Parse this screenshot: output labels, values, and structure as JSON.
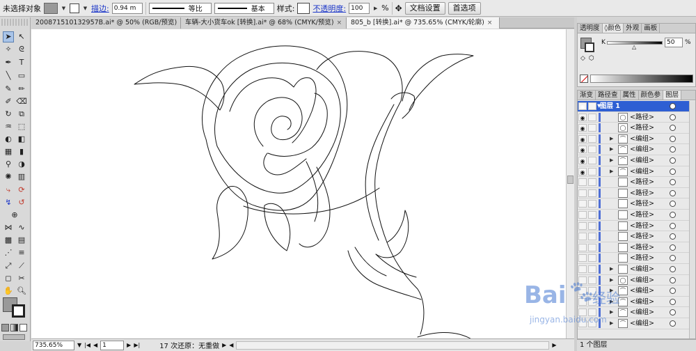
{
  "control_bar": {
    "selection_status": "未选择对象",
    "stroke_label": "描边:",
    "stroke_weight": "0.94 m",
    "variable_width_profile": "等比",
    "brush_definition": "基本",
    "style_label": "样式:",
    "opacity_label": "不透明度:",
    "opacity_value": "100",
    "opacity_unit": "%",
    "document_setup_label": "文档设置",
    "preferences_label": "首选项"
  },
  "doc_tabs": [
    {
      "label": "200871510132957B.ai* @ 50% (RGB/预览)",
      "active": false
    },
    {
      "label": "车辆-大小货车ok [转换].ai* @ 68% (CMYK/预览)",
      "active": false
    },
    {
      "label": "805_b [转换].ai* @ 735.65% (CMYK/轮廓)",
      "active": true
    }
  ],
  "status_bar": {
    "zoom": "735.65%",
    "artboard": "1",
    "undo_status": "17 次还原：无重做"
  },
  "color_panel": {
    "tabs": [
      "透明度",
      "颜色",
      "外观",
      "画板"
    ],
    "active_tab": "颜色",
    "k_label": "K",
    "k_value": "50",
    "k_unit": "%"
  },
  "layers_panel": {
    "tabs": [
      "渐变",
      "路径查",
      "属性",
      "颜色参",
      "图层"
    ],
    "active_tab": "图层",
    "layer_name": "图层 1",
    "items": [
      {
        "label": "<路径>",
        "thumb": "circle",
        "has_arrow": false
      },
      {
        "label": "<路径>",
        "thumb": "circle",
        "has_arrow": false
      },
      {
        "label": "<编组>",
        "thumb": "shape",
        "has_arrow": true
      },
      {
        "label": "<编组>",
        "thumb": "shape",
        "has_arrow": true
      },
      {
        "label": "<编组>",
        "thumb": "shape",
        "has_arrow": true
      },
      {
        "label": "<编组>",
        "thumb": "shape",
        "has_arrow": true
      },
      {
        "label": "<路径>",
        "thumb": "plain",
        "has_arrow": false
      },
      {
        "label": "<路径>",
        "thumb": "plain",
        "has_arrow": false
      },
      {
        "label": "<路径>",
        "thumb": "plain",
        "has_arrow": false
      },
      {
        "label": "<路径>",
        "thumb": "plain",
        "has_arrow": false
      },
      {
        "label": "<路径>",
        "thumb": "plain",
        "has_arrow": false
      },
      {
        "label": "<路径>",
        "thumb": "plain",
        "has_arrow": false
      },
      {
        "label": "<路径>",
        "thumb": "plain",
        "has_arrow": false
      },
      {
        "label": "<路径>",
        "thumb": "plain",
        "has_arrow": false
      },
      {
        "label": "<编组>",
        "thumb": "plain",
        "has_arrow": true
      },
      {
        "label": "<编组>",
        "thumb": "circle",
        "has_arrow": true
      },
      {
        "label": "<编组>",
        "thumb": "shape",
        "has_arrow": true
      },
      {
        "label": "<编组>",
        "thumb": "shape",
        "has_arrow": true
      },
      {
        "label": "<编组>",
        "thumb": "shape",
        "has_arrow": true
      },
      {
        "label": "<编组>",
        "thumb": "shape",
        "has_arrow": true
      }
    ],
    "footer": "1 个图层"
  },
  "watermark": {
    "brand": "Bai",
    "brand_tail": "经验",
    "url": "jingyan.baidu.com"
  },
  "colors": {
    "selected_row": "#2e5fd3",
    "layer_color_bar": "#4f6fd6",
    "link_blue": "#1a35c8"
  }
}
